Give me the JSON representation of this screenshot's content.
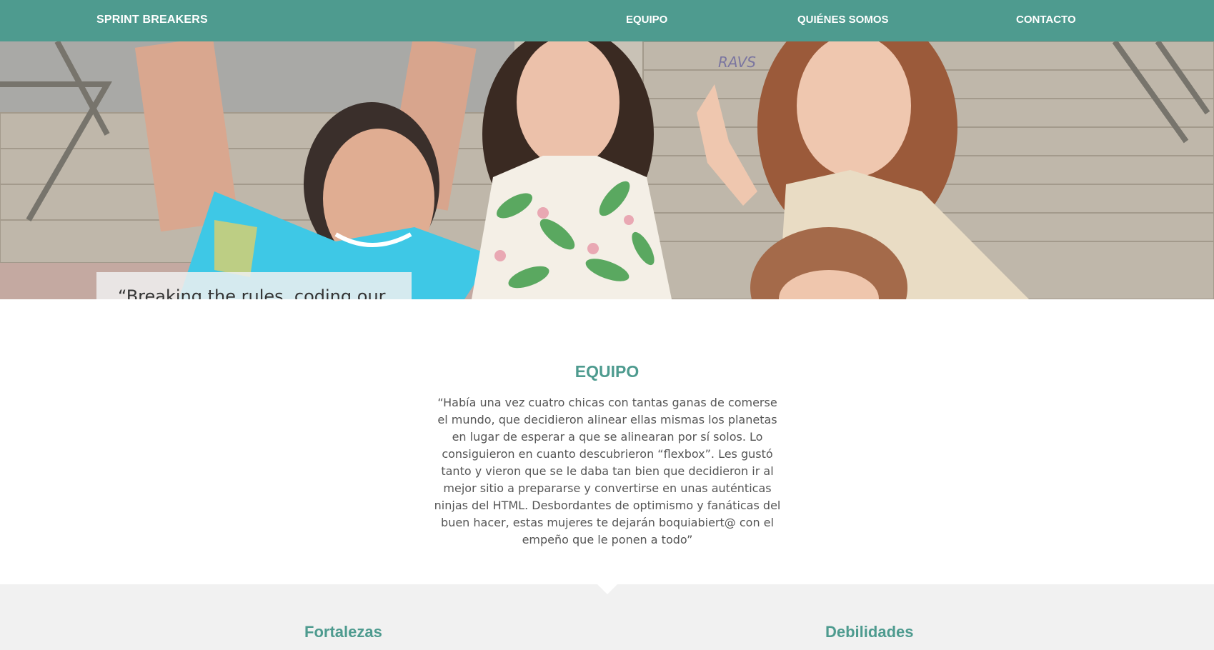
{
  "colors": {
    "accent": "#4e9b8f",
    "band": "#f1f1f1"
  },
  "nav": {
    "brand": "SPRINT BREAKERS",
    "links": [
      "EQUIPO",
      "QUIÉNES SOMOS",
      "CONTACTO"
    ]
  },
  "hero": {
    "quote": "“Breaking the rules, coding our own”",
    "image": "group-photo-four-women-on-stairs"
  },
  "equipo": {
    "title": "EQUIPO",
    "text": "“Había una vez cuatro chicas con tantas ganas de comerse el mundo, que decidieron alinear ellas mismas los planetas en lugar de esperar a que se alinearan por sí solos. Lo consiguieron en cuanto descubrieron “flexbox”. Les gustó tanto y vieron que se le daba tan bien que decidieron ir al mejor sitio a prepararse y convertirse en unas auténticas ninjas del HTML. Desbordantes de optimismo y fanáticas del buen hacer, estas mujeres te dejarán boquiabiert@ con el empeño que le ponen a todo”"
  },
  "swot": {
    "left_title": "Fortalezas",
    "right_title": "Debilidades"
  }
}
